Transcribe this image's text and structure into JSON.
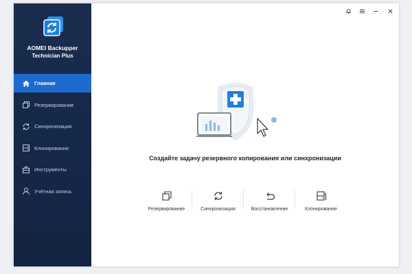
{
  "app": {
    "name": "AOMEI Backupper",
    "edition": "Technician Plus"
  },
  "window_controls": {
    "icons": [
      "bell-icon",
      "menu-icon",
      "minimize-icon",
      "close-icon"
    ]
  },
  "sidebar": {
    "items": [
      {
        "label": "Главная",
        "icon": "home-icon",
        "active": true
      },
      {
        "label": "Резервирование",
        "icon": "backup-icon",
        "active": false
      },
      {
        "label": "Синхронизация",
        "icon": "sync-icon",
        "active": false
      },
      {
        "label": "Клонирование",
        "icon": "clone-icon",
        "active": false
      },
      {
        "label": "Инструменты",
        "icon": "tools-icon",
        "active": false
      },
      {
        "label": "Учётная запись",
        "icon": "user-icon",
        "active": false
      }
    ]
  },
  "main": {
    "prompt": "Создайте задачу резервного копирования или синхронизации",
    "actions": [
      {
        "label": "Резервирование",
        "icon": "backup-icon"
      },
      {
        "label": "Синхронизация",
        "icon": "sync-icon"
      },
      {
        "label": "Восстановление",
        "icon": "restore-icon"
      },
      {
        "label": "Клонирование",
        "icon": "clone-icon"
      }
    ]
  },
  "colors": {
    "sidebar_bg": "#17294a",
    "accent": "#1e6bd0",
    "hero_plus": "#1f7fe0"
  }
}
